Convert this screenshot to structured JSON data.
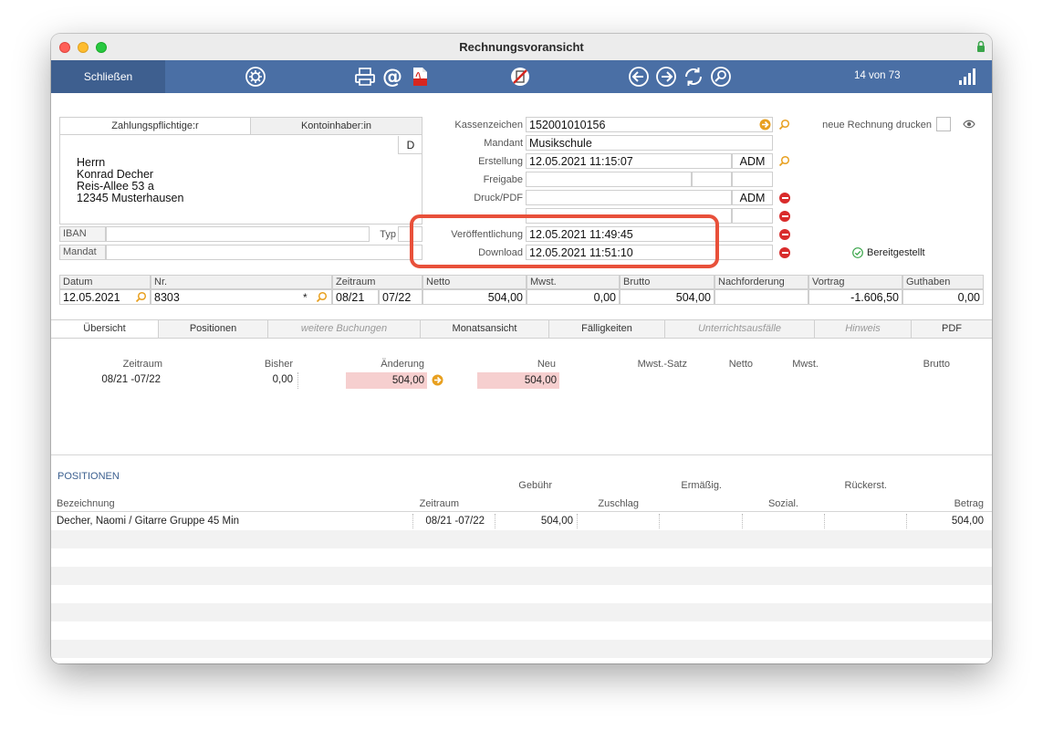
{
  "window": {
    "title": "Rechnungsvoransicht"
  },
  "toolbar": {
    "close_label": "Schließen",
    "counter": "14 von 73"
  },
  "address": {
    "tab_payer": "Zahlungspflichtige:r",
    "tab_account": "Kontoinhaber:in",
    "lang": "D",
    "lines": [
      "Herrn",
      "Konrad Decher",
      "Reis-Allee 53 a",
      "12345 Musterhausen"
    ],
    "iban_label": "IBAN",
    "typ_label": "Typ",
    "mandat_label": "Mandat"
  },
  "details": {
    "kassenzeichen_label": "Kassenzeichen",
    "kassenzeichen": "152001010156",
    "mandant_label": "Mandant",
    "mandant": "Musikschule",
    "erstellung_label": "Erstellung",
    "erstellung": "12.05.2021 11:15:07",
    "erstellung_user": "ADM",
    "freigabe_label": "Freigabe",
    "druck_label": "Druck/PDF",
    "druck_user": "ADM",
    "veroeffentlichung_label": "Veröffentlichung",
    "veroeffentlichung": "12.05.2021 11:49:45",
    "download_label": "Download",
    "download": "12.05.2021 11:51:10",
    "reprint_label": "neue Rechnung drucken",
    "status_label": "Bereitgestellt"
  },
  "summary": {
    "headers": [
      "Datum",
      "Nr.",
      "Zeitraum",
      "Netto",
      "Mwst.",
      "Brutto",
      "Nachforderung",
      "Vortrag",
      "Guthaben"
    ],
    "datum": "12.05.2021",
    "nr": "8303",
    "star": "*",
    "period_from": "08/21",
    "period_to": "07/22",
    "netto": "504,00",
    "mwst": "0,00",
    "brutto": "504,00",
    "nachforderung": "",
    "vortrag": "-1.606,50",
    "guthaben": "0,00"
  },
  "tabs": [
    "Übersicht",
    "Positionen",
    "weitere Buchungen",
    "Monatsansicht",
    "Fälligkeiten",
    "Unterrichtsausfälle",
    "Hinweis",
    "PDF"
  ],
  "overview": {
    "headers": {
      "zeitraum": "Zeitraum",
      "bisher": "Bisher",
      "aenderung": "Änderung",
      "neu": "Neu",
      "satz": "Mwst.-Satz",
      "netto": "Netto",
      "mwst": "Mwst.",
      "brutto": "Brutto"
    },
    "row": {
      "zeitraum": "08/21 -07/22",
      "bisher": "0,00",
      "aenderung": "504,00",
      "neu": "504,00"
    }
  },
  "positions": {
    "section_title": "POSITIONEN",
    "headers": {
      "gebuehr": "Gebühr",
      "ermaessig": "Ermäßig.",
      "rueckerst": "Rückerst.",
      "bezeichnung": "Bezeichnung",
      "zeitraum": "Zeitraum",
      "zuschlag": "Zuschlag",
      "sozial": "Sozial.",
      "betrag": "Betrag"
    },
    "rows": [
      {
        "bezeichnung": "Decher, Naomi / Gitarre Gruppe 45 Min",
        "zeitraum": "08/21 -07/22",
        "gebuehr": "504,00",
        "betrag": "504,00"
      }
    ]
  },
  "colors": {
    "toolbar": "#4a6fa5",
    "highlight": "#e8503a",
    "accent": "#e8a020",
    "delete": "#d92b2b",
    "pink": "#f6cfcf"
  }
}
